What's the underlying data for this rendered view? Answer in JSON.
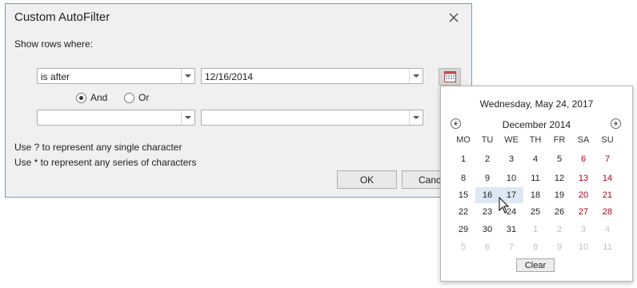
{
  "dialog": {
    "title": "Custom AutoFilter",
    "subtitle": "Show rows where:",
    "operator1": "is after",
    "value1": "12/16/2014",
    "operator2": "",
    "value2": "",
    "and_label": "And",
    "or_label": "Or",
    "and_selected": true,
    "hint1": "Use ? to represent any single character",
    "hint2": "Use * to represent any series of characters",
    "ok_label": "OK",
    "cancel_label": "Cance"
  },
  "calendar": {
    "today": "Wednesday, May 24, 2017",
    "month": "December 2014",
    "weekdays": [
      "MO",
      "TU",
      "WE",
      "TH",
      "FR",
      "SA",
      "SU"
    ],
    "weeks": [
      [
        "1",
        "2",
        "3",
        "4",
        "5",
        "6",
        "7"
      ],
      [
        "8",
        "9",
        "10",
        "11",
        "12",
        "13",
        "14"
      ],
      [
        "15",
        "16",
        "17",
        "18",
        "19",
        "20",
        "21"
      ],
      [
        "22",
        "23",
        "24",
        "25",
        "26",
        "27",
        "28"
      ],
      [
        "29",
        "30",
        "31",
        "1",
        "2",
        "3",
        "4"
      ],
      [
        "5",
        "6",
        "7",
        "8",
        "9",
        "10",
        "11"
      ]
    ],
    "selected_day": "16",
    "hover_day": "17",
    "clear_label": "Clear",
    "weekend_color": "#b00020"
  }
}
